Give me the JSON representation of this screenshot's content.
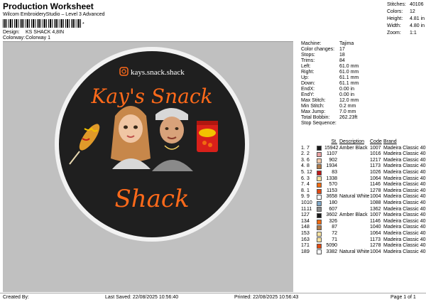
{
  "header": {
    "title": "Production Worksheet",
    "subtitle": "Wilcom EmbroideryStudio – Level 3 Advanced",
    "barcode_tail": "*",
    "design_label": "Design:",
    "design_value": "KS SHACK 4,8IN",
    "colorway_label": "Colorway:",
    "colorway_value": "Colorway 1"
  },
  "summary": [
    {
      "label": "Stitches:",
      "value": "40106"
    },
    {
      "label": "Colors:",
      "value": "12"
    },
    {
      "label": "Height:",
      "value": "4.81 in"
    },
    {
      "label": "Width:",
      "value": "4.80 in"
    },
    {
      "label": "Zoom:",
      "value": "1:1"
    }
  ],
  "design": {
    "instagram": "kays.snack.shack",
    "line1": "Kay's Snack",
    "line2": "Shack",
    "colors": {
      "patch": "#1f1f1f",
      "border": "#f2f2f2",
      "neon": "#ff6a1a",
      "canvas": "#c0c0c0"
    }
  },
  "machine_info": [
    {
      "label": "Machine:",
      "value": "Tajima"
    },
    {
      "label": "Color changes:",
      "value": "17"
    },
    {
      "label": "Stops:",
      "value": "18"
    },
    {
      "label": "Trims:",
      "value": "84"
    },
    {
      "label": "Left:",
      "value": "61.0 mm"
    },
    {
      "label": "Right:",
      "value": "61.0 mm"
    },
    {
      "label": "Up:",
      "value": "61.1 mm"
    },
    {
      "label": "Down:",
      "value": "61.1 mm"
    },
    {
      "label": "EndX:",
      "value": "0.00 in"
    },
    {
      "label": "EndY:",
      "value": "0.00 in"
    },
    {
      "label": "Max Stitch:",
      "value": "12.0 mm"
    },
    {
      "label": "Min Stitch:",
      "value": "0.2 mm"
    },
    {
      "label": "Max Jump:",
      "value": "7.0 mm"
    },
    {
      "label": "Total Bobbin:",
      "value": "262.23ft"
    }
  ],
  "stop_sequence": {
    "title": "Stop Sequence:",
    "headers": {
      "st": "St.",
      "desc": "Description",
      "code": "Code",
      "brand": "Brand"
    },
    "rows": [
      {
        "n": "1.",
        "s": "7",
        "swatch": "#1a1a1a",
        "st": "15942",
        "desc": "Amber Black",
        "code": "1007",
        "brand": "Madeira Classic 40"
      },
      {
        "n": "2.",
        "s": "2",
        "swatch": "#e8a0a0",
        "st": "1107",
        "desc": "",
        "code": "1016",
        "brand": "Madeira Classic 40"
      },
      {
        "n": "3.",
        "s": "6",
        "swatch": "#f3c9a8",
        "st": "902",
        "desc": "",
        "code": "1217",
        "brand": "Madeira Classic 40"
      },
      {
        "n": "4.",
        "s": "8",
        "swatch": "#b07a4a",
        "st": "1934",
        "desc": "",
        "code": "1173",
        "brand": "Madeira Classic 40"
      },
      {
        "n": "5.",
        "s": "12",
        "swatch": "#c01a1a",
        "st": "83",
        "desc": "",
        "code": "1026",
        "brand": "Madeira Classic 40"
      },
      {
        "n": "6.",
        "s": "3",
        "swatch": "#f7e2a0",
        "st": "1338",
        "desc": "",
        "code": "1064",
        "brand": "Madeira Classic 40"
      },
      {
        "n": "7.",
        "s": "4",
        "swatch": "#f06a10",
        "st": "570",
        "desc": "",
        "code": "1146",
        "brand": "Madeira Classic 40"
      },
      {
        "n": "8.",
        "s": "1",
        "swatch": "#e04a12",
        "st": "1153",
        "desc": "",
        "code": "1278",
        "brand": "Madeira Classic 40"
      },
      {
        "n": "9.",
        "s": "9",
        "swatch": "#ffffff",
        "st": "3658",
        "desc": "Natural White",
        "code": "1004",
        "brand": "Madeira Classic 40"
      },
      {
        "n": "10.",
        "s": "10",
        "swatch": "#7fa8c8",
        "st": "180",
        "desc": "",
        "code": "1088",
        "brand": "Madeira Classic 40"
      },
      {
        "n": "11.",
        "s": "11",
        "swatch": "#8a8a8a",
        "st": "607",
        "desc": "",
        "code": "1362",
        "brand": "Madeira Classic 40"
      },
      {
        "n": "12.",
        "s": "7",
        "swatch": "#1a1a1a",
        "st": "3602",
        "desc": "Amber Black",
        "code": "1007",
        "brand": "Madeira Classic 40"
      },
      {
        "n": "13.",
        "s": "4",
        "swatch": "#f06a10",
        "st": "326",
        "desc": "",
        "code": "1146",
        "brand": "Madeira Classic 40"
      },
      {
        "n": "14.",
        "s": "8",
        "swatch": "#b07a4a",
        "st": "87",
        "desc": "",
        "code": "1040",
        "brand": "Madeira Classic 40"
      },
      {
        "n": "15.",
        "s": "3",
        "swatch": "#f7e2a0",
        "st": "72",
        "desc": "",
        "code": "1064",
        "brand": "Madeira Classic 40"
      },
      {
        "n": "16.",
        "s": "3",
        "swatch": "#f7e2a0",
        "st": "71",
        "desc": "",
        "code": "1173",
        "brand": "Madeira Classic 40"
      },
      {
        "n": "17.",
        "s": "1",
        "swatch": "#e04a12",
        "st": "5090",
        "desc": "",
        "code": "1278",
        "brand": "Madeira Classic 40"
      },
      {
        "n": "18.",
        "s": "9",
        "swatch": "#ffffff",
        "st": "3382",
        "desc": "Natural White",
        "code": "1004",
        "brand": "Madeira Classic 40"
      }
    ]
  },
  "footer": {
    "created": "Created By:",
    "saved": "Last Saved: 22/08/2025 10:56:40",
    "printed": "Printed: 22/08/2025 10:56:43",
    "page": "Page 1 of 1"
  }
}
